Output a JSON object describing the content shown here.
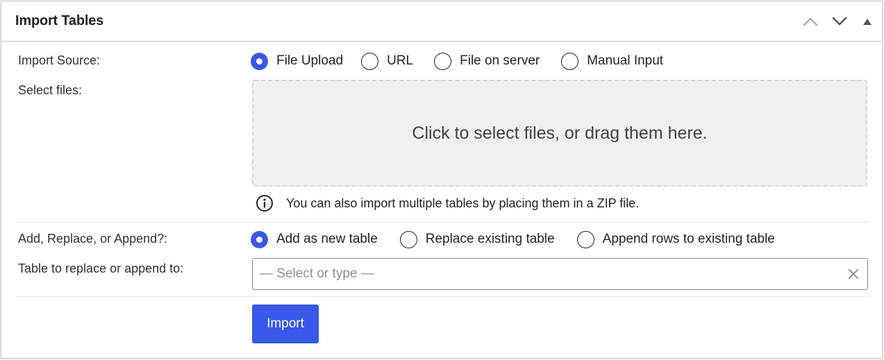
{
  "panel": {
    "title": "Import Tables",
    "controls": {
      "move_up_icon": "chevron-up-icon",
      "move_down_icon": "chevron-down-icon",
      "toggle_icon": "triangle-up-icon"
    }
  },
  "import_source": {
    "label": "Import Source:",
    "options": [
      {
        "label": "File Upload",
        "checked": true
      },
      {
        "label": "URL",
        "checked": false
      },
      {
        "label": "File on server",
        "checked": false
      },
      {
        "label": "Manual Input",
        "checked": false
      }
    ]
  },
  "select_files": {
    "label": "Select files:",
    "dropzone_text": "Click to select files, or drag them here.",
    "hint": "You can also import multiple tables by placing them in a ZIP file.",
    "hint_icon": "info-icon"
  },
  "import_type": {
    "label": "Add, Replace, or Append?:",
    "options": [
      {
        "label": "Add as new table",
        "checked": true
      },
      {
        "label": "Replace existing table",
        "checked": false
      },
      {
        "label": "Append rows to existing table",
        "checked": false
      }
    ]
  },
  "target_table": {
    "label": "Table to replace or append to:",
    "placeholder": "— Select or type —",
    "value": "",
    "clear_icon": "close-icon"
  },
  "actions": {
    "import_label": "Import"
  },
  "colors": {
    "accent": "#3858e9",
    "dropzone_bg": "#f0f0f1",
    "border": "#c3c4c7"
  }
}
